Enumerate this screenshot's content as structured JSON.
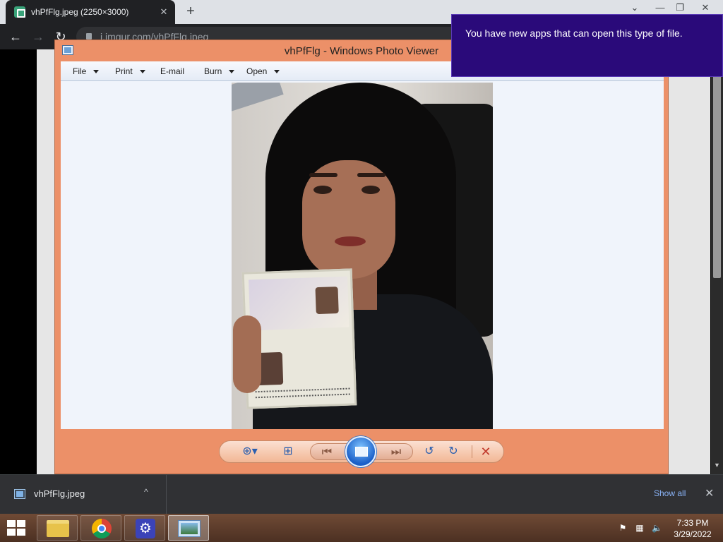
{
  "browser": {
    "tab_title": "vhPfFlg.jpeg (2250×3000)",
    "tab_close": "✕",
    "new_tab": "+",
    "url": "i.imgur.com/vhPfFlg.jpeg",
    "back": "←",
    "forward": "→",
    "reload": "↻",
    "minimize": "—",
    "restore": "❐",
    "close": "✕",
    "expand": "⌄"
  },
  "viewer": {
    "title": "vhPfFlg - Windows Photo Viewer",
    "menu": [
      {
        "label": "File",
        "has_caret": true
      },
      {
        "label": "Print",
        "has_caret": true
      },
      {
        "label": "E-mail",
        "has_caret": false
      },
      {
        "label": "Burn",
        "has_caret": true
      },
      {
        "label": "Open",
        "has_caret": true
      }
    ],
    "controls": {
      "zoom": "⊕▾",
      "actual_size": "⊞",
      "previous": "⏮",
      "next": "⏭",
      "rotate_ccw": "↺",
      "rotate_cw": "↻",
      "delete": "✕"
    }
  },
  "toast": {
    "message": "You have new apps that can open this type of file."
  },
  "downloads": {
    "file_name": "vhPfFlg.jpeg",
    "caret": "^",
    "show_all": "Show all",
    "close": "✕"
  },
  "taskbar": {
    "time": "7:33 PM",
    "date": "3/29/2022",
    "gear_glyph": "⚙",
    "tray": {
      "flag": "⚑",
      "network": "▦",
      "volume": "🔈"
    }
  },
  "colors": {
    "viewer_frame": "#ec9068",
    "toast_bg": "#2a0a7a",
    "taskbar": "#5e3c2b"
  }
}
